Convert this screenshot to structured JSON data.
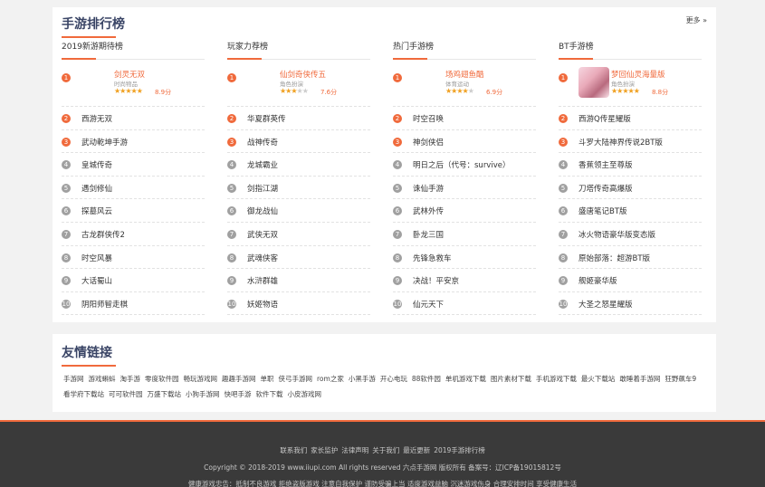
{
  "rank": {
    "title": "手游排行榜",
    "more": "更多 »",
    "columns": [
      {
        "heading": "2019新游期待榜",
        "top": {
          "name": "剑灵无双",
          "category": "时尚物品",
          "stars": 4.5,
          "score": "8.9分",
          "has_image": false
        },
        "items": [
          "西游无双",
          "武动乾坤手游",
          "皇城传奇",
          "遇剑修仙",
          "探墓风云",
          "古龙群侠传2",
          "时空风暴",
          "大话蜀山",
          "阴阳师智走棋"
        ]
      },
      {
        "heading": "玩家力荐榜",
        "top": {
          "name": "仙剑奇侠传五",
          "category": "角色扮演",
          "stars": 3,
          "score": "7.6分",
          "has_image": false
        },
        "items": [
          "华夏群英传",
          "战神传奇",
          "龙城霸业",
          "剑指江湖",
          "御龙战仙",
          "武侠无双",
          "武魂侠客",
          "水浒群雄",
          "妖姬物语"
        ]
      },
      {
        "heading": "热门手游榜",
        "top": {
          "name": "场鸡翅鱼酷",
          "category": "体育运动",
          "stars": 3.5,
          "score": "6.9分",
          "has_image": false
        },
        "items": [
          "时空召唤",
          "神剑侠侣",
          "明日之后（代号：survive）",
          "诛仙手游",
          "武林外传",
          "卧龙三国",
          "先锋急救车",
          "决战！平安京",
          "仙元天下"
        ]
      },
      {
        "heading": "BT手游榜",
        "top": {
          "name": "梦回仙灵海量版",
          "category": "角色扮演",
          "stars": 4.5,
          "score": "8.8分",
          "has_image": true
        },
        "items": [
          "西游Q传星耀版",
          "斗罗大陆神界传说2BT版",
          "香蕉领主至尊版",
          "刀塔传奇高爆版",
          "盛唐笔记BT版",
          "冰火物语豪华版变态版",
          "原始部落：超游BT版",
          "舰姬豪华版",
          "大圣之怒星耀版"
        ]
      }
    ]
  },
  "links": {
    "title": "友情链接",
    "items": [
      "手游网",
      "游戏蝌蚪",
      "淘手游",
      "零度软件园",
      "畅玩游戏网",
      "趣趣手游网",
      "单职",
      "侠弓手游网",
      "rom之家",
      "小黑手游",
      "开心电玩",
      "88软件园",
      "单机游戏下载",
      "图片素材下载",
      "手机游戏下载",
      "最火下载站",
      "敢睡着手游网",
      "狂野飙车9",
      "看学府下载站",
      "可可软件园",
      "万盛下载站",
      "小狗手游网",
      "快吧手游",
      "软件下载",
      "小皮游戏网"
    ]
  },
  "footer": {
    "nav": [
      "联系我们",
      "家长监护",
      "法律声明",
      "关于我们",
      "最近更新",
      "2019手游排行榜"
    ],
    "copyright": "Copyright © 2018-2019 www.iiupi.com All rights reserved 六点手游网 版权所有 备案号：辽ICP备19015812号",
    "notice": "健康游戏忠告：抵制不良游戏 拒绝盗版游戏 注意自我保护 谨防受骗上当 适度游戏益脑 沉迷游戏伤身 合理安排时间 享受健康生活"
  },
  "colors": {
    "accent": "#f06a3c",
    "title": "#3a4566",
    "footer_bg": "#3a3a3a",
    "star": "#f0a020"
  }
}
